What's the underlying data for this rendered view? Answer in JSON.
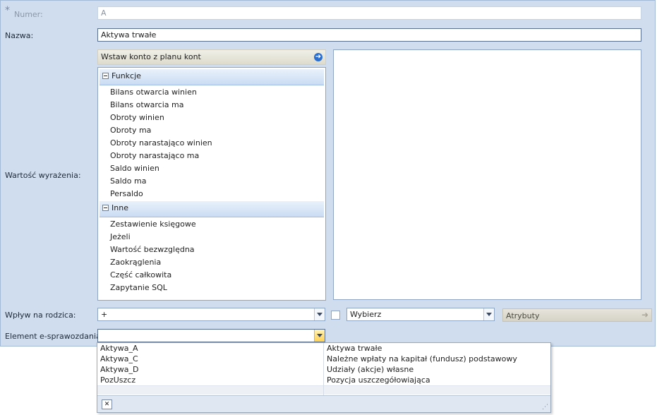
{
  "form": {
    "numer_label": "Numer:",
    "numer_value": "A",
    "nazwa_label": "Nazwa:",
    "nazwa_value": "Aktywa trwałe",
    "wartosc_label": "Wartość wyrażenia:",
    "insert_account_label": "Wstaw konto z planu kont",
    "wplyw_label": "Wpływ na rodzica:",
    "wplyw_value": "+",
    "wybierz_value": "Wybierz",
    "atrybuty_label": "Atrybuty",
    "element_label": "Element e-sprawozdania",
    "element_value": ""
  },
  "functions": {
    "group1_label": "Funkcje",
    "group1_items": [
      "Bilans otwarcia winien",
      "Bilans otwarcia ma",
      "Obroty winien",
      "Obroty ma",
      "Obroty narastająco winien",
      "Obroty narastająco ma",
      "Saldo winien",
      "Saldo ma",
      "Persaldo"
    ],
    "group2_label": "Inne",
    "group2_items": [
      "Zestawienie księgowe",
      "Jeżeli",
      "Wartość bezwzględna",
      "Zaokrąglenia",
      "Część całkowita",
      "Zapytanie SQL"
    ]
  },
  "dropdown": {
    "rows": [
      {
        "code": "Aktywa_A",
        "name": "Aktywa trwałe"
      },
      {
        "code": "Aktywa_C",
        "name": "Należne wpłaty na kapitał (fundusz) podstawowy"
      },
      {
        "code": "Aktywa_D",
        "name": "Udziały (akcje) własne"
      },
      {
        "code": "PozUszcz",
        "name": "Pozycja uszczegółowiająca"
      }
    ]
  },
  "icons": {
    "required": "asterisk-icon",
    "insert": "arrow-right-icon",
    "attributes": "arrow-right-icon",
    "clear": "clear-icon",
    "resize": "resize-grip-icon"
  },
  "colors": {
    "panel_bg": "#cfddee",
    "group_header": "#cadcf3",
    "accent_blue": "#2a6fd0",
    "combo_highlight": "#ffd254"
  }
}
